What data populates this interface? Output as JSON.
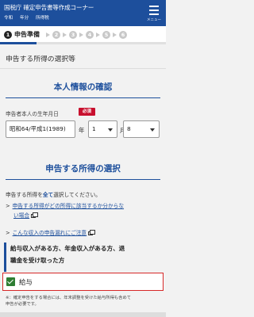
{
  "header": {
    "title": "国税庁 確定申告書等作成コーナー",
    "subs": [
      "令和",
      "年分",
      "所得税"
    ],
    "menu_label": "メニュー"
  },
  "steps": {
    "numbers": [
      "1",
      "2",
      "3",
      "4",
      "5",
      "6"
    ],
    "active_label": "申告準備"
  },
  "page_title": "申告する所得の選択等",
  "personal_info": {
    "heading": "本人情報の確認",
    "birth_label": "申告者本人の生年月日",
    "required_badge": "必須",
    "era_value": "昭和64/平成1(1989)",
    "month_value": "1",
    "day_value": "8"
  },
  "income_select": {
    "heading": "申告する所得の選択",
    "intro_prefix": "申告する所得を",
    "intro_emph": "全て",
    "intro_suffix": "選択してください。",
    "link1_line1": "申告する所得がどの所得に該当するか分からな",
    "link1_line2": "い場合",
    "link2": "こんな収入の申告漏れにご注意",
    "box_line1": "給与収入がある方、年金収入がある方、退",
    "box_line2": "職金を受け取った方",
    "kyuyo_label": "給与",
    "kyuyo_checked": true,
    "note_line1": "※：確定申告をする場合には、年末調整を受けた給与所得も含めて",
    "note_line2": "申告が必要です。"
  },
  "colors": {
    "header_bg": "#1d4f9c",
    "accent": "#1d4f9c",
    "required": "#c8102e",
    "highlight_border": "#d62828",
    "checkbox": "#2e7d32"
  }
}
